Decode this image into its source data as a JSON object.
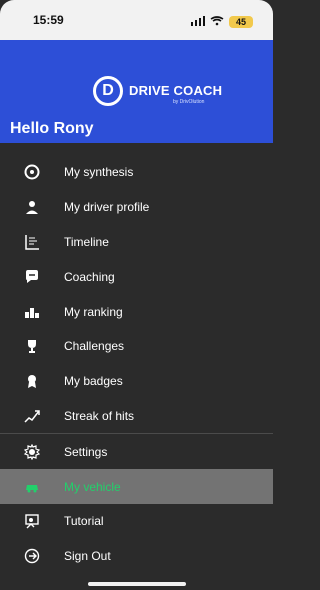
{
  "status": {
    "time": "15:59",
    "signal": "signal-icon",
    "wifi": "wifi-icon",
    "battery": "45"
  },
  "header": {
    "brand": "DRIVE COACH",
    "sub": "by DrivOlution",
    "greeting": "Hello Rony"
  },
  "menu": [
    {
      "label": "My synthesis",
      "icon": "steering-wheel-icon"
    },
    {
      "label": "My driver profile",
      "icon": "person-icon"
    },
    {
      "label": "Timeline",
      "icon": "timeline-icon"
    },
    {
      "label": "Coaching",
      "icon": "chat-bubble-icon"
    },
    {
      "label": "My ranking",
      "icon": "podium-icon"
    },
    {
      "label": "Challenges",
      "icon": "trophy-icon"
    },
    {
      "label": "My badges",
      "icon": "badge-icon"
    },
    {
      "label": "Streak of hits",
      "icon": "streak-icon"
    },
    {
      "label": "Settings",
      "icon": "gear-icon"
    },
    {
      "label": "My vehicle",
      "icon": "car-icon"
    },
    {
      "label": "Tutorial",
      "icon": "tutorial-icon"
    },
    {
      "label": "Sign Out",
      "icon": "sign-out-icon"
    }
  ],
  "colors": {
    "header": "#2d4fd7",
    "menu": "#2b2b2b",
    "active": "#737373",
    "activeText": "#22d06b"
  }
}
